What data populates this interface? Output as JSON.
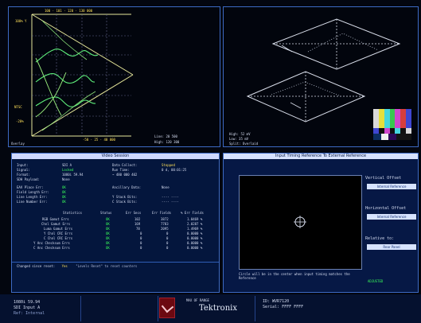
{
  "waveform": {
    "top_scale": "100 · 101 · 120 · 130 000",
    "left_labels": [
      "100% Y",
      "NTSC",
      "-20%"
    ],
    "bottom_scale": "-50 · 25 · 40 000",
    "mode": "Overlay",
    "line": "Line: 20 500",
    "field": "High: 120 300"
  },
  "vector": {
    "readouts": [
      "High: 52 mV",
      "Low: 35 mV",
      "Split: Overlaid"
    ]
  },
  "status": {
    "title": "Video Session",
    "rows": [
      {
        "label": "Input:",
        "value": "SDI A",
        "label2": "Data Collect:",
        "value2": "Stopped"
      },
      {
        "label": "Signal:",
        "value": "Locked",
        "label2": "Run Time:",
        "value2": "0 d, 00:01:25"
      },
      {
        "label": "Format:",
        "value": "1080i 59.94",
        "label2": "",
        "value2": "~ 480 000 402"
      },
      {
        "label": "SDH Payload:",
        "value": "None",
        "label2": "",
        "value2": ""
      },
      {
        "label": "EAV Place Err:",
        "value": "OK",
        "label2": "Ancillary Data:",
        "value2": "None"
      },
      {
        "label": "Field Length Err:",
        "value": "OK",
        "label2": "",
        "value2": ""
      },
      {
        "label": "Line Length Err:",
        "value": "OK",
        "label2": "Y Stack Bits:",
        "value2": "---- ----"
      },
      {
        "label": "Line Number Err:",
        "value": "OK",
        "label2": "C Stack Bits:",
        "value2": "---- ----"
      }
    ],
    "table_headers": [
      "Statistics",
      "Status",
      "Err Secs",
      "Err Fields",
      "% Err Fields"
    ],
    "table_rows": [
      [
        "RGB Gamut Errs",
        "OK",
        "102",
        "3872",
        "1.0469 %"
      ],
      [
        "Chnl Gamut Errs",
        "OK",
        "169",
        "7783",
        "2.0287 %"
      ],
      [
        "Luma Gamut Errs",
        "OK",
        "78",
        "2095",
        "1.4969 %"
      ],
      [
        "Y Chnl CRC Errs",
        "OK",
        "0",
        "0",
        "0.0000 %"
      ],
      [
        "C Chnl CRC Errs",
        "OK",
        "0",
        "0",
        "0.0000 %"
      ],
      [
        "Y Anc Checksum Errs",
        "OK",
        "0",
        "0",
        "0.0000 %"
      ],
      [
        "C Anc Checksum Errs",
        "OK",
        "0",
        "0",
        "0.0000 %"
      ]
    ],
    "footer_left": "Changed since reset:",
    "footer_value": "Yes",
    "footer_note": "\"Levels Reset\" to reset counters"
  },
  "timing": {
    "title": "Input Timing Reference To External Reference",
    "vertical_label": "Vertical Offset",
    "vertical_value": "Internal Reference",
    "horizontal_label": "Horizontal Offset",
    "horizontal_value": "Internal Reference",
    "relative_label": "Relative to:",
    "relative_value": "Rear Panel",
    "note": "Circle will be in the center when input timing matches the Reference",
    "bottom_status": "ADJUSTED"
  },
  "bottom_bar": {
    "left_line1": "1080i 59.94",
    "left_line2": "SDI Input A",
    "left_line3": "Ref: Internal",
    "mid_label": "MAX OF RANGE",
    "brand": "Tektronix",
    "right_line1": "ID: WVR7120",
    "right_line2": "Serial: FFFF FFFF"
  }
}
